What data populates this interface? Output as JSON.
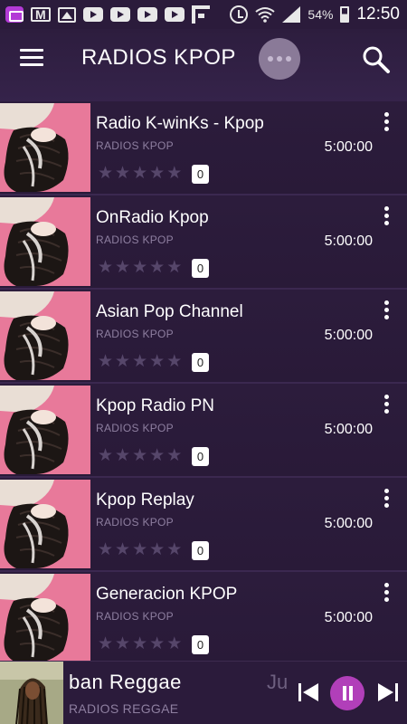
{
  "status_bar": {
    "battery": "54%",
    "time": "12:50",
    "icons": [
      "app-notification-icon",
      "gmail-icon",
      "gallery-icon",
      "youtube-icon",
      "youtube-icon",
      "youtube-icon",
      "youtube-icon",
      "flipboard-icon",
      "alarm-icon",
      "wifi-icon",
      "signal-icon",
      "battery-icon"
    ]
  },
  "app_bar": {
    "title": "RADIOS KPOP",
    "icons": [
      "menu-icon",
      "loading-dots-icon",
      "search-icon"
    ]
  },
  "stations": [
    {
      "name": "Radio K-winKs - Kpop",
      "genre": "RADIOS KPOP",
      "duration": "5:00:00",
      "rating": 0,
      "rating_count": "0"
    },
    {
      "name": "OnRadio Kpop",
      "genre": "RADIOS KPOP",
      "duration": "5:00:00",
      "rating": 0,
      "rating_count": "0"
    },
    {
      "name": "Asian Pop Channel",
      "genre": "RADIOS KPOP",
      "duration": "5:00:00",
      "rating": 0,
      "rating_count": "0"
    },
    {
      "name": "Kpop Radio PN",
      "genre": "RADIOS KPOP",
      "duration": "5:00:00",
      "rating": 0,
      "rating_count": "0"
    },
    {
      "name": "Kpop Replay",
      "genre": "RADIOS KPOP",
      "duration": "5:00:00",
      "rating": 0,
      "rating_count": "0"
    },
    {
      "name": "Generacion KPOP",
      "genre": "RADIOS KPOP",
      "duration": "5:00:00",
      "rating": 0,
      "rating_count": "0"
    }
  ],
  "player": {
    "title": "ban Reggae",
    "next_title": "Ju",
    "genre": "RADIOS REGGAE",
    "state": "playing"
  },
  "colors": {
    "background": "#2a1838",
    "accent": "#b13fb9",
    "thumbnail_pink": "#e8799a",
    "muted_text": "#8e7fa0"
  }
}
